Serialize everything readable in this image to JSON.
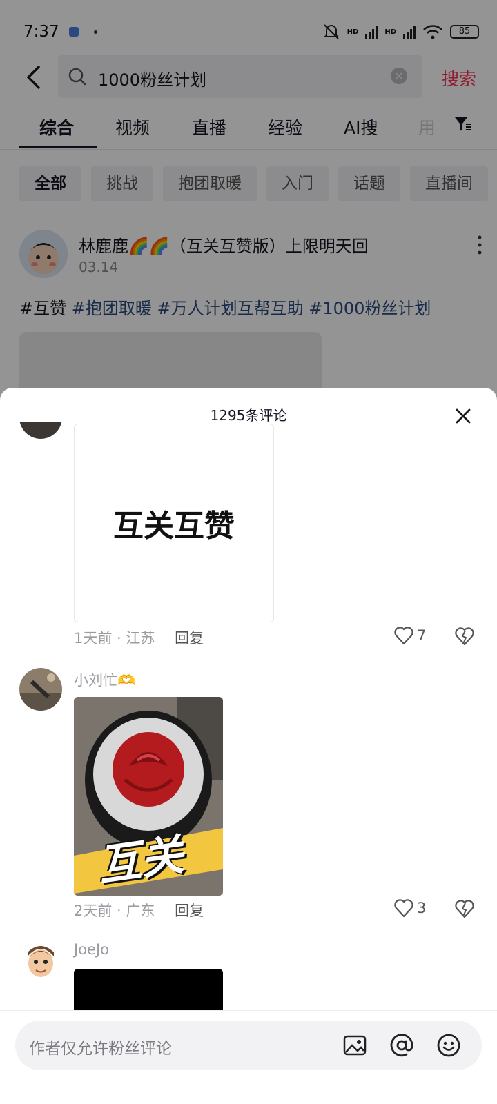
{
  "status_bar": {
    "time": "7:37",
    "battery": "85",
    "hd1": "HD",
    "hd2": "HD"
  },
  "search": {
    "query": "1000粉丝计划",
    "button_label": "搜索"
  },
  "tabs": [
    {
      "label": "综合",
      "active": true
    },
    {
      "label": "视频"
    },
    {
      "label": "直播"
    },
    {
      "label": "经验"
    },
    {
      "label": "AI搜"
    },
    {
      "label": "用"
    }
  ],
  "chips": [
    {
      "label": "全部",
      "active": true
    },
    {
      "label": "挑战"
    },
    {
      "label": "抱团取暖"
    },
    {
      "label": "入门"
    },
    {
      "label": "话题"
    },
    {
      "label": "直播间"
    }
  ],
  "post": {
    "author": "林鹿鹿🌈🌈（互关互赞版）上限明天回",
    "date": "03.14",
    "tag_plain": "#互赞",
    "tags": [
      "#抱团取暖",
      "#万人计划互帮互助",
      "#1000粉丝计划"
    ]
  },
  "comments_sheet": {
    "title": "1295条评论",
    "comments": [
      {
        "image_text": "互关互赞",
        "time": "1天前",
        "location": "江苏",
        "reply_label": "回复",
        "likes": "7"
      },
      {
        "username": "小刘忙🫶",
        "image_text": "互关",
        "time": "2天前",
        "location": "广东",
        "reply_label": "回复",
        "likes": "3"
      },
      {
        "username": "JoeJo"
      }
    ],
    "input_placeholder": "作者仅允许粉丝评论"
  },
  "colors": {
    "accent": "#fe2c55",
    "tag_link": "#2b4b7d"
  }
}
